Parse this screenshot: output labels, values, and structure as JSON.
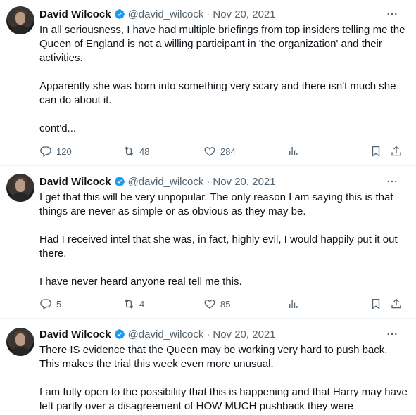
{
  "tweets": [
    {
      "author": "David Wilcock",
      "handle": "@david_wilcock",
      "separator": "·",
      "date": "Nov 20, 2021",
      "paragraphs": [
        "In all seriousness, I have had multiple briefings from top insiders telling me the Queen of England is not a willing participant in 'the organization' and their activities.",
        "Apparently she was born into something very scary and there isn't much she can do about it.",
        "cont'd..."
      ],
      "replies": "120",
      "retweets": "48",
      "likes": "284"
    },
    {
      "author": "David Wilcock",
      "handle": "@david_wilcock",
      "separator": "·",
      "date": "Nov 20, 2021",
      "paragraphs": [
        "I get that this will be very unpopular. The only reason I am saying this is that things are never as simple or as obvious as they may be.",
        "Had I received intel that she was, in fact, highly evil, I would happily put it out there.",
        "I have never heard anyone real tell me this."
      ],
      "replies": "5",
      "retweets": "4",
      "likes": "85"
    },
    {
      "author": "David Wilcock",
      "handle": "@david_wilcock",
      "separator": "·",
      "date": "Nov 20, 2021",
      "paragraphs": [
        "There IS evidence that the Queen may be working very hard to push back. This makes the trial this week even more unusual.",
        "I am fully open to the possibility that this is happening and that Harry may have left partly over a disagreement of HOW MUCH pushback they were"
      ]
    }
  ],
  "colors": {
    "text": "#0f1419",
    "secondary": "#536471",
    "verified": "#1d9bf0",
    "divider": "#eff3f4"
  },
  "icons": {
    "more": "more-icon",
    "reply": "reply-icon",
    "retweet": "retweet-icon",
    "like": "heart-icon",
    "views": "views-icon",
    "bookmark": "bookmark-icon",
    "share": "share-icon",
    "verified": "verified-badge-icon"
  }
}
